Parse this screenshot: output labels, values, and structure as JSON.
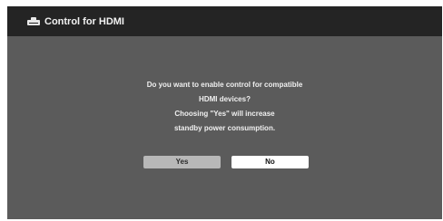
{
  "header": {
    "icon": "toolbox-icon",
    "title": "Control for HDMI"
  },
  "dialog": {
    "lines": [
      "Do you want to enable control for compatible",
      "HDMI devices?",
      "Choosing \"Yes\" will increase",
      "standby power consumption."
    ],
    "buttons": {
      "yes_label": "Yes",
      "no_label": "No"
    }
  },
  "colors": {
    "background": "#5b5b5b",
    "header": "#242424",
    "button_selected": "#b8b8b8",
    "button_default": "#ffffff"
  }
}
